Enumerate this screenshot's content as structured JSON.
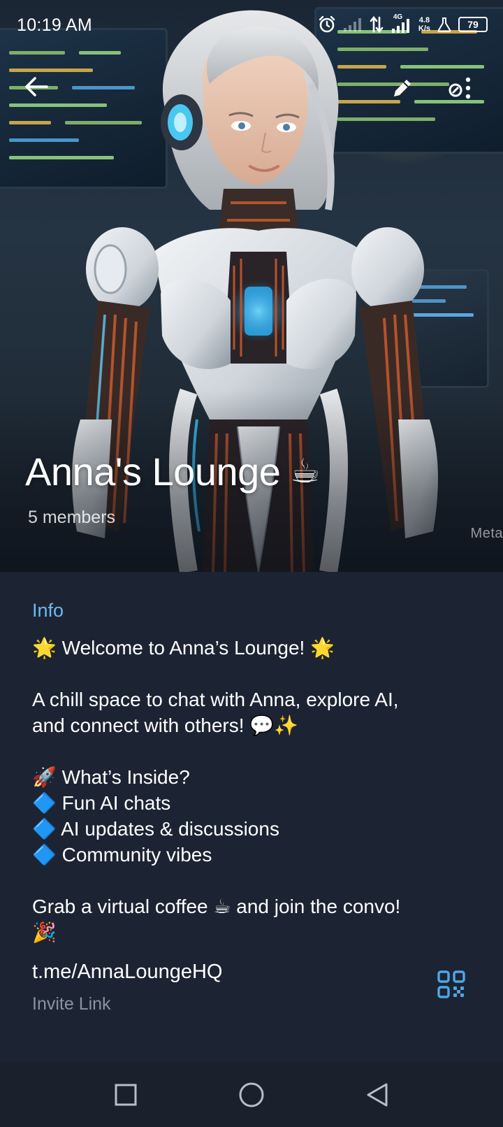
{
  "status_bar": {
    "time": "10:19 AM",
    "network_type": "4G",
    "speed_value": "4.8",
    "speed_unit": "K/s",
    "battery": "79",
    "icons": [
      "alarm-icon",
      "signal-icon",
      "data-arrows-icon",
      "signal-4g-icon",
      "lab-icon",
      "battery-icon"
    ]
  },
  "toolbar": {
    "back_icon": "arrow-left-icon",
    "edit_icon": "pencil-icon",
    "more_icon": "more-vertical-icon"
  },
  "header": {
    "title": "Anna's Lounge",
    "title_emoji": "☕",
    "subtitle": "5 members",
    "image_watermark": "Meta"
  },
  "info": {
    "heading": "Info",
    "description": {
      "welcome": "🌟 Welcome to Anna’s Lounge! 🌟",
      "intro_line1": "A chill space to chat with Anna, explore AI,",
      "intro_line2": "and connect with others! 💬✨",
      "inside_title": "🚀 What’s Inside?",
      "bullets": [
        "🔷 Fun AI chats",
        "🔷 AI updates & discussions",
        "🔷 Community vibes"
      ],
      "closing_line1": "Grab a virtual coffee ☕ and join the convo!",
      "closing_line2": "🎉"
    },
    "link": "t.me/AnnaLoungeHQ",
    "link_label": "Invite Link",
    "qr_icon": "qr-code-icon"
  },
  "nav_bar": {
    "recents_icon": "square-icon",
    "home_icon": "circle-icon",
    "back_icon": "triangle-back-icon"
  },
  "colors": {
    "background": "#1c2433",
    "accent": "#6cb8f2",
    "secondary_text": "#8794a3",
    "nav_bar": "#1a212d"
  }
}
